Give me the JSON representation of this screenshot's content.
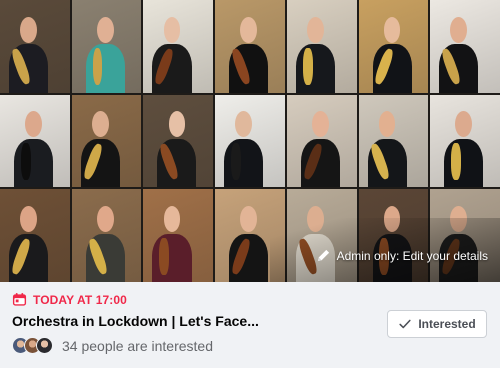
{
  "event": {
    "date_text": "TODAY AT 17:00",
    "title": "Orchestra in Lockdown | Let's Face...",
    "interested_count_text": "34 people are interested",
    "interested_button_label": "Interested",
    "admin_edit_text": "Admin only: Edit your details"
  },
  "colors": {
    "date_accent": "#f02849",
    "title_text": "#050505",
    "secondary_text": "#65676b",
    "background": "#f0f2f5",
    "button_border": "#ccd0d5"
  },
  "icons": {
    "calendar": "calendar-icon",
    "pencil": "pencil-icon",
    "check": "check-icon"
  },
  "avatars": [
    "avatar-1",
    "avatar-2",
    "avatar-3"
  ],
  "tiles": [
    {
      "wall": "#5a4a3a",
      "skin": "#d9a88a",
      "shirt": "#1c1c22",
      "inst": "#c9a24a"
    },
    {
      "wall": "#8a8070",
      "skin": "#e0b094",
      "shirt": "#3aa39a",
      "inst": "#c9a24a"
    },
    {
      "wall": "#e8e4da",
      "skin": "#e6bea4",
      "shirt": "#1a1a1a",
      "inst": "#7a3b1a"
    },
    {
      "wall": "#b99868",
      "skin": "#e4b89a",
      "shirt": "#111111",
      "inst": "#8a4520"
    },
    {
      "wall": "#d8cfc0",
      "skin": "#e2b598",
      "shirt": "#16181c",
      "inst": "#d4b048"
    },
    {
      "wall": "#c8a060",
      "skin": "#e6bb9c",
      "shirt": "#111317",
      "inst": "#d9b24c"
    },
    {
      "wall": "#ece8e2",
      "skin": "#e0ae90",
      "shirt": "#121214",
      "inst": "#c9a24a"
    },
    {
      "wall": "#e9e6e1",
      "skin": "#dca88c",
      "shirt": "#1a1c20",
      "inst": "#0d0d0d"
    },
    {
      "wall": "#8a6a48",
      "skin": "#dcae90",
      "shirt": "#141414",
      "inst": "#cfa848"
    },
    {
      "wall": "#5e4e3e",
      "skin": "#e6c0a6",
      "shirt": "#1a1a1a",
      "inst": "#8b4a22"
    },
    {
      "wall": "#efeeea",
      "skin": "#e0b89c",
      "shirt": "#121418",
      "inst": "#1a1a1a"
    },
    {
      "wall": "#d6ccbe",
      "skin": "#e4b296",
      "shirt": "#151515",
      "inst": "#5a2e16"
    },
    {
      "wall": "#cfc8bc",
      "skin": "#e2b090",
      "shirt": "#141619",
      "inst": "#d6b24e"
    },
    {
      "wall": "#e8e4de",
      "skin": "#dcaa8e",
      "shirt": "#101216",
      "inst": "#d4b048"
    },
    {
      "wall": "#6e5036",
      "skin": "#dca486",
      "shirt": "#1a1a1c",
      "inst": "#cfa848"
    },
    {
      "wall": "#8b6c4c",
      "skin": "#e0a88a",
      "shirt": "#3a3b36",
      "inst": "#d4b048"
    },
    {
      "wall": "#a07048",
      "skin": "#e6b89a",
      "shirt": "#5a1e2a",
      "inst": "#8b4a22"
    },
    {
      "wall": "#c6a27a",
      "skin": "#e2b496",
      "shirt": "#141414",
      "inst": "#7a3b1a"
    },
    {
      "wall": "#b8ab98",
      "skin": "#dcae90",
      "shirt": "#d8d2c6",
      "inst": "#8b4a22"
    },
    {
      "wall": "#5b4636",
      "skin": "#dca88a",
      "shirt": "#141416",
      "inst": "#8b4a22"
    },
    {
      "wall": "#b0a290",
      "skin": "#deae90",
      "shirt": "#1e1e1e",
      "inst": "#6a3a1c"
    }
  ]
}
